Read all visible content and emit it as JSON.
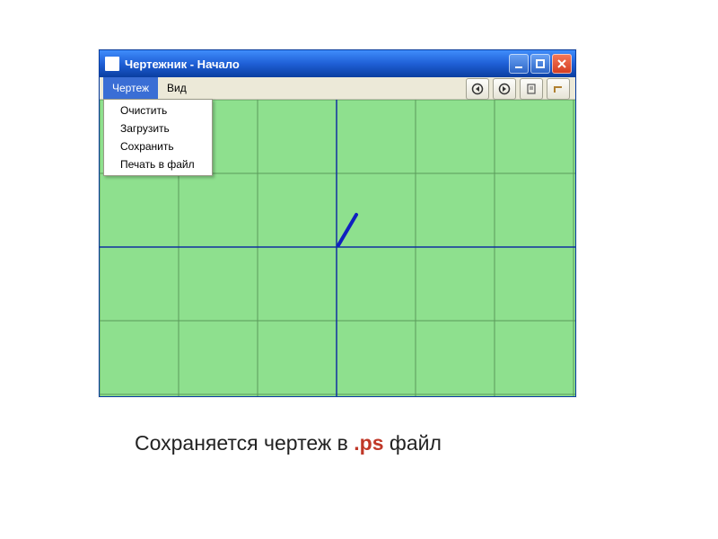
{
  "window": {
    "title": "Чертежник - Начало"
  },
  "menubar": {
    "items": [
      "Чертеж",
      "Вид"
    ],
    "dropdown": [
      "Очистить",
      "Загрузить",
      "Сохранить",
      "Печать в файл"
    ]
  },
  "caption": {
    "part1": "Сохраняется  чертеж в ",
    "ext": ".ps",
    "part2": " файл"
  }
}
